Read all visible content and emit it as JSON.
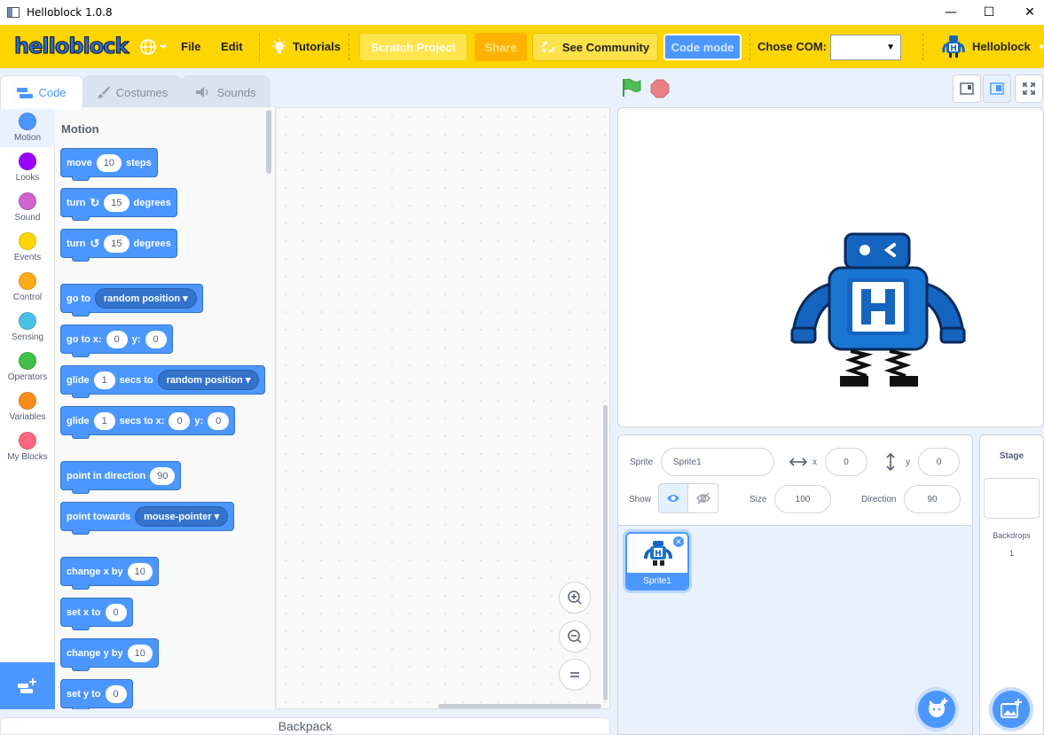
{
  "window": {
    "title": "Helloblock 1.0.8",
    "minimize": "—",
    "maximize": "☐",
    "close": "✕"
  },
  "menu": {
    "logo": "helloblock",
    "file": "File",
    "edit": "Edit",
    "tutorials": "Tutorials",
    "scratch_project": "Scratch Project",
    "share": "Share",
    "see_community": "See Community",
    "code_mode": "Code mode",
    "com_label": "Chose COM:",
    "com_value": "",
    "user": "Helloblock"
  },
  "tabs": {
    "code": "Code",
    "costumes": "Costumes",
    "sounds": "Sounds"
  },
  "categories": [
    {
      "label": "Motion",
      "color": "#4c97ff"
    },
    {
      "label": "Looks",
      "color": "#9900ff"
    },
    {
      "label": "Sound",
      "color": "#cf63cf"
    },
    {
      "label": "Events",
      "color": "#ffd500"
    },
    {
      "label": "Control",
      "color": "#ffab19"
    },
    {
      "label": "Sensing",
      "color": "#4cbfe6"
    },
    {
      "label": "Operators",
      "color": "#40bf4a"
    },
    {
      "label": "Variables",
      "color": "#ff8c1a"
    },
    {
      "label": "My Blocks",
      "color": "#ff6680"
    }
  ],
  "palette": {
    "title": "Motion",
    "blocks": {
      "move": {
        "pre": "move",
        "val": "10",
        "post": "steps"
      },
      "turn_right": {
        "pre": "turn",
        "val": "15",
        "post": "degrees"
      },
      "turn_left": {
        "pre": "turn",
        "val": "15",
        "post": "degrees"
      },
      "goto": {
        "pre": "go to",
        "menu": "random position"
      },
      "goto_xy": {
        "pre": "go to x:",
        "x": "0",
        "mid": "y:",
        "y": "0"
      },
      "glide_to": {
        "pre": "glide",
        "val": "1",
        "mid": "secs to",
        "menu": "random position"
      },
      "glide_xy": {
        "pre": "glide",
        "val": "1",
        "mid": "secs to x:",
        "x": "0",
        "mid2": "y:",
        "y": "0"
      },
      "point_dir": {
        "pre": "point in direction",
        "val": "90"
      },
      "point_towards": {
        "pre": "point towards",
        "menu": "mouse-pointer"
      },
      "change_x": {
        "pre": "change x by",
        "val": "10"
      },
      "set_x": {
        "pre": "set x to",
        "val": "0"
      },
      "change_y": {
        "pre": "change y by",
        "val": "10"
      },
      "set_y": {
        "pre": "set y to",
        "val": "0"
      }
    }
  },
  "backpack": "Backpack",
  "sprite_info": {
    "sprite_label": "Sprite",
    "sprite_name": "Sprite1",
    "x_label": "x",
    "x_value": "0",
    "y_label": "y",
    "y_value": "0",
    "show_label": "Show",
    "size_label": "Size",
    "size_value": "100",
    "direction_label": "Direction",
    "direction_value": "90"
  },
  "sprites": [
    {
      "name": "Sprite1"
    }
  ],
  "stage_panel": {
    "title": "Stage",
    "backdrops_label": "Backdrops",
    "backdrops_count": "1"
  },
  "colors": {
    "accent": "#4c97ff",
    "menubar": "#ffd500",
    "robot_blue": "#1565c0"
  }
}
